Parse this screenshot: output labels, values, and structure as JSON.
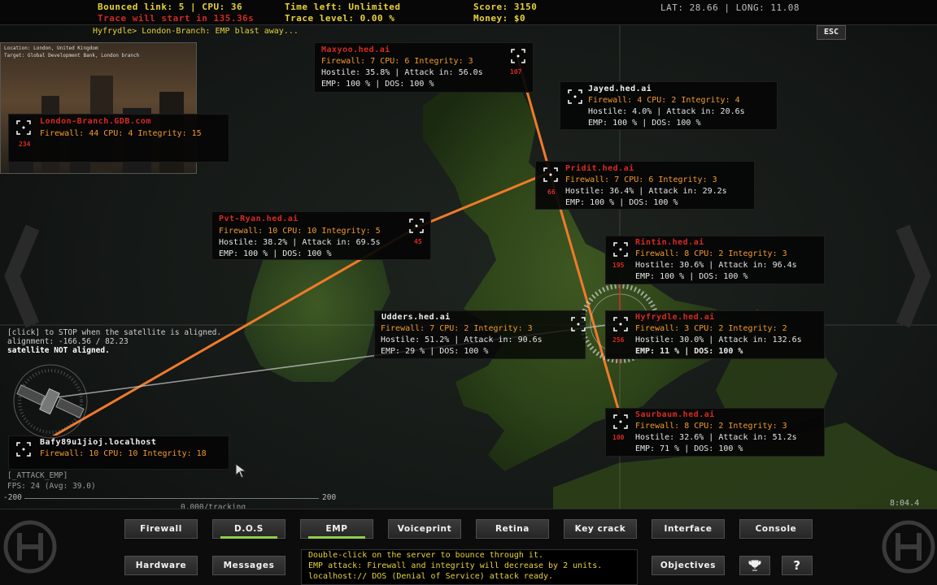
{
  "hud": {
    "bounced_link": "Bounced link: 5 | CPU: 36",
    "trace_start": "Trace will start in 135.36s",
    "time_left": "Time left: Unlimited",
    "trace_level": "Trace level: 0.00 %",
    "score": "Score: 3150",
    "money": "Money: $0",
    "coords": "LAT: 28.66 | LONG: 11.08"
  },
  "message_line": "Hyfrydle> London-Branch: EMP blast away...",
  "esc_label": "ESC",
  "location": {
    "line1": "Location: London, United Kingdom",
    "line2": "Target: Global Development Bank, London branch"
  },
  "servers": {
    "london": {
      "name": "London-Branch.GDB.com",
      "l1": "Firewall: 44 CPU: 4 Integrity: 15",
      "num": "234"
    },
    "maxyoo": {
      "name": "Maxyoo.hed.ai",
      "l1": "Firewall: 7 CPU: 6 Integrity: 3",
      "l2": "Hostile: 35.8% | Attack in: 56.0s",
      "l3": "EMP: 100 % | DOS: 100 %",
      "num": "107"
    },
    "jayed": {
      "name": "Jayed.hed.ai",
      "l1": "Firewall: 4 CPU: 2 Integrity: 4",
      "l2": "Hostile: 4.0% | Attack in: 20.6s",
      "l3": "EMP: 100 % | DOS: 100 %"
    },
    "pridit": {
      "name": "Pridit.hed.ai",
      "l1": "Firewall: 7 CPU: 6 Integrity: 3",
      "l2": "Hostile: 36.4% | Attack in: 29.2s",
      "l3": "EMP: 100 % | DOS: 100 %",
      "num": "66"
    },
    "pvtryan": {
      "name": "Pvt-Ryan.hed.ai",
      "l1": "Firewall: 10 CPU: 10 Integrity: 5",
      "l2": "Hostile: 38.2% | Attack in: 69.5s",
      "l3": "EMP: 100 % | DOS: 100 %",
      "num": "45"
    },
    "rintin": {
      "name": "Rintin.hed.ai",
      "l1": "Firewall: 8 CPU: 2 Integrity: 3",
      "l2": "Hostile: 30.6% | Attack in: 96.4s",
      "l3": "EMP: 100 % | DOS: 100 %",
      "num": "195"
    },
    "udders": {
      "name": "Udders.hed.ai",
      "l1": "Firewall: 7 CPU: 2 Integrity: 3",
      "l2": "Hostile: 51.2% | Attack in: 90.6s",
      "l3": "EMP:  29 % | DOS: 100 %"
    },
    "hyfrydle": {
      "name": "Hyfrydle.hed.ai",
      "l1": "Firewall: 3 CPU: 2 Integrity: 2",
      "l2": "Hostile: 30.0% | Attack in: 132.6s",
      "l3": "EMP:  11 % | DOS: 100 %",
      "num": "256"
    },
    "saurbaum": {
      "name": "Saurbaum.hed.ai",
      "l1": "Firewall: 8 CPU: 2 Integrity: 3",
      "l2": "Hostile: 32.6% | Attack in: 51.2s",
      "l3": "EMP:  71 % | DOS: 100 %",
      "num": "100"
    },
    "localhost": {
      "name": "Bafy89u1jioj.localhost",
      "l1": "Firewall: 10 CPU: 10 Integrity: 18"
    }
  },
  "satellite": {
    "click": "[click] to STOP when the satellite is aligned.",
    "alignment": "alignment: -166.56 / 82.23",
    "status": "satellite NOT aligned."
  },
  "console": {
    "attack": "[_ATTACK_EMP]",
    "fps": "FPS:  24 (Avg: 39.0)",
    "scale_min": "-200",
    "scale_max": "200",
    "tracking": "0.000/tracking"
  },
  "clock": "8:04.4",
  "buttons_row1": [
    "Firewall",
    "D.O.S",
    "EMP",
    "Voiceprint",
    "Retina",
    "Key crack",
    "Interface",
    "Console"
  ],
  "buttons_row2": [
    "Hardware",
    "Messages"
  ],
  "objectives_label": "Objectives",
  "help_label": "?",
  "info": [
    "Double-click on the server to bounce through it.",
    "EMP attack: Firewall and integrity will decrease by 2 units.",
    "localhost:// DOS (Denial of Service) attack ready."
  ],
  "colors": {
    "accent_yellow": "#e8d23a",
    "alert_red": "#d62a24",
    "link_orange": "#f07a2a",
    "active_green": "#8fd04a"
  },
  "icons": [
    "crosshair-target-icon",
    "satellite-icon",
    "trophy-icon",
    "hed-logo-icon"
  ]
}
